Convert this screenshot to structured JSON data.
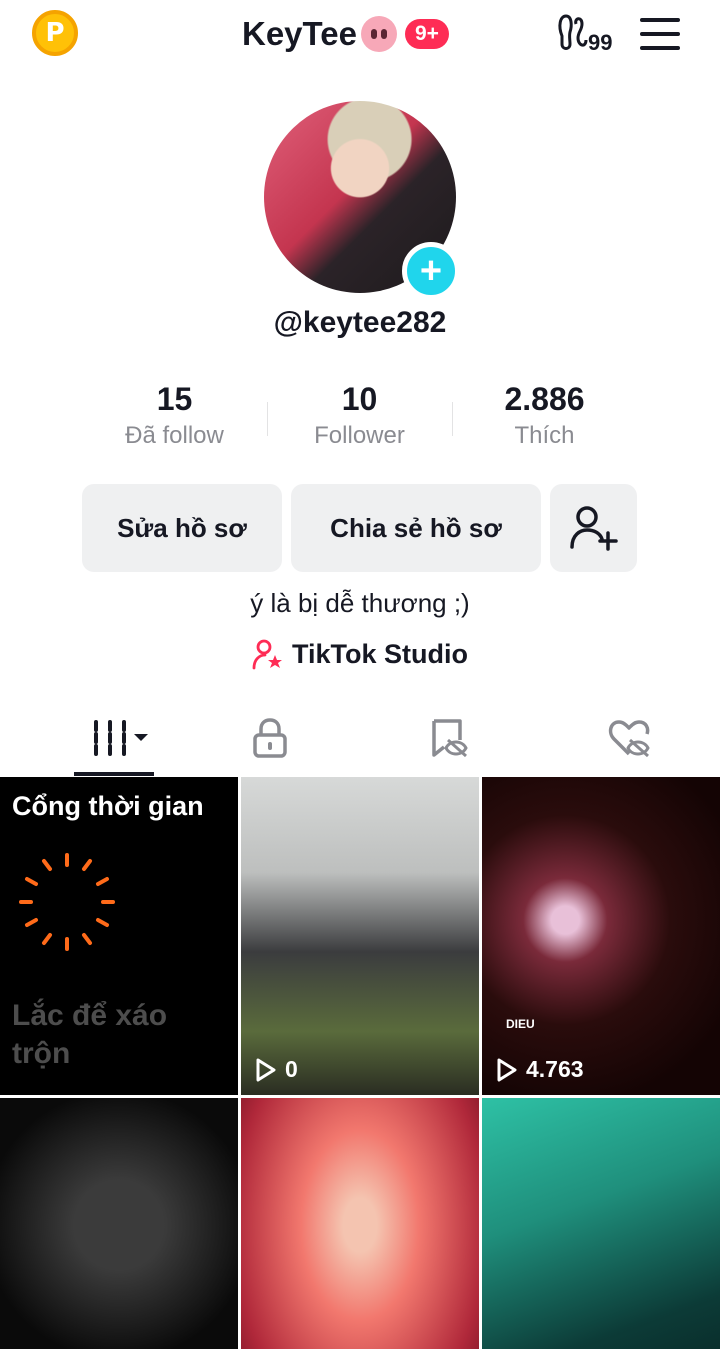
{
  "header": {
    "coin_label": "P",
    "title": "KeyTee",
    "badge": "9+",
    "feet_count": "99"
  },
  "profile": {
    "username": "@keytee282",
    "stats": [
      {
        "value": "15",
        "label": "Đã follow"
      },
      {
        "value": "10",
        "label": "Follower"
      },
      {
        "value": "2.886",
        "label": "Thích"
      }
    ],
    "edit_button": "Sửa hồ sơ",
    "share_button": "Chia sẻ hồ sơ",
    "bio": "ý là bị dễ thương ;)",
    "studio_label": "TikTok Studio"
  },
  "grid": {
    "timeline_title": "Cổng thời gian",
    "timeline_sub": "Lắc để xáo trộn",
    "videos": [
      {
        "views": "0"
      },
      {
        "views": "4.763",
        "overlay": "DIEU"
      }
    ]
  },
  "colors": {
    "accent": "#FE2C55",
    "plus": "#20D5EC",
    "coin": "#FFC107",
    "spinner": "#FF6B1A"
  }
}
